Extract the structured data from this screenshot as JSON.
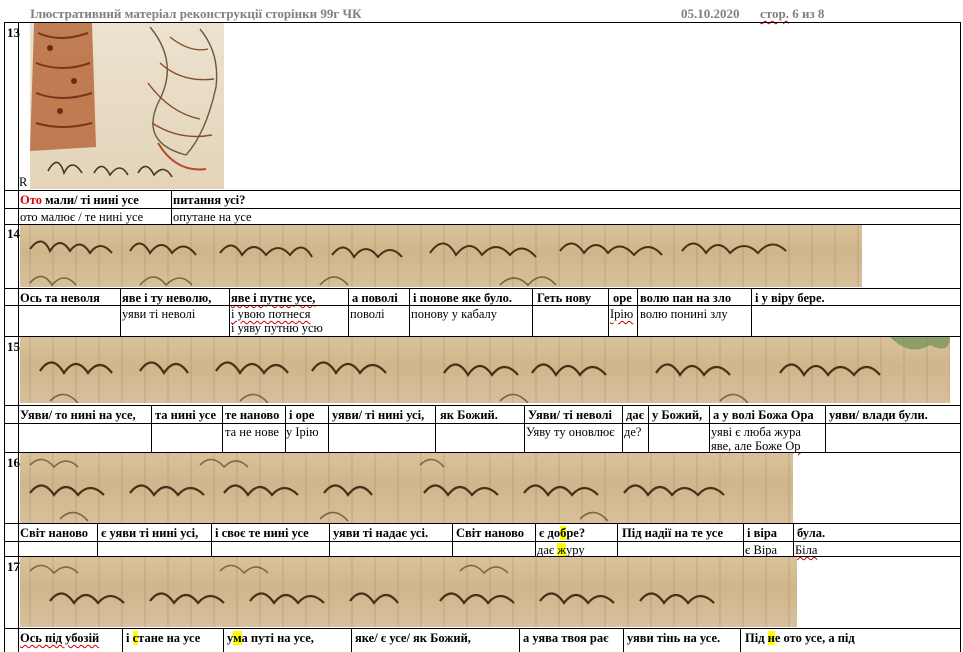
{
  "header": {
    "title": "Ілюстративний матеріал  реконструкції сторінки 99г ЧК",
    "date": "05.10.2020",
    "page_prefix": "стор.",
    "page_rest": " 6 из 8"
  },
  "r_label": "R",
  "blocks": [
    {
      "number": "13",
      "top_pre": "Ото",
      "top": [
        " мали/ ті нині усе",
        "питання усі?"
      ],
      "bottom": [
        "ото малює / те нині усе",
        "опутане на усе"
      ]
    },
    {
      "number": "14",
      "top": [
        "Ось та неволя",
        "яве і ту неволю,",
        "яве і путнє усе,",
        "а поволі",
        "і понове яке було.",
        "Геть нову",
        "оре",
        "волю пан на зло",
        "і у віру бере."
      ],
      "bottom": [
        "уяви ті неволі",
        "і увою потнеся",
        "і уяву путню усю",
        "поволі",
        "понову у кабалу",
        "Ірію",
        "волю понині злу"
      ]
    },
    {
      "number": "15",
      "top": [
        "Уяви/ то нині на усе,",
        "та нині усе",
        "те наново",
        "і оре",
        "уяви/ ті нині усі,",
        "як Божий.",
        "Уяви/ ті неволі",
        "дає",
        "у Божий,",
        "а у волі Божа Ора",
        "уяви/ влади були."
      ],
      "bottom": [
        "та не нове",
        "у Ірію",
        "Уяву ту оновлює",
        "де?",
        "уяві є люба жура",
        "яве, але Боже Ор"
      ]
    },
    {
      "number": "16",
      "top": [
        "Світ наново",
        "є уяви ті нині усі,",
        "і своє те нині усе",
        "уяви ті надає усі.",
        "Світ наново",
        "є до",
        "б",
        "ре?",
        "Під надії на те усе",
        "і віра",
        "була."
      ],
      "bottom": [
        "дає ",
        "ж",
        "уру",
        "є Віра",
        "Біла"
      ]
    },
    {
      "number": "17",
      "top": [
        "Ось під убозій",
        "і ",
        "с",
        "тане на усе",
        "у",
        "м",
        "а путі на усе,",
        "яке/ є усе/ як Божий,",
        "а уява твоя рає",
        "уяви тінь на усе.",
        "Під ",
        "н",
        "е ото усе, а під"
      ]
    }
  ]
}
